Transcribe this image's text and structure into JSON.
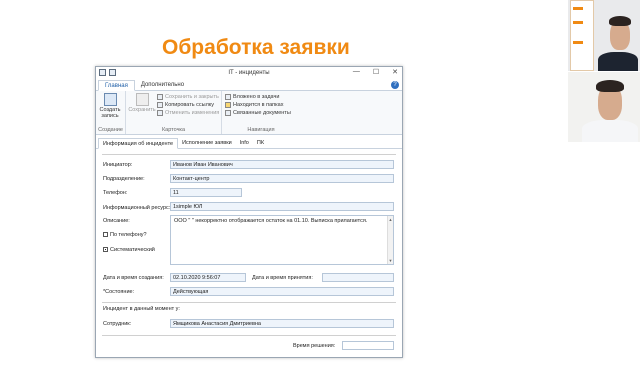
{
  "slide": {
    "title": "Обработка заявки"
  },
  "window": {
    "title": "IT - инциденты",
    "minimize": "—",
    "maximize": "☐",
    "close": "✕",
    "help": "?"
  },
  "ribbon": {
    "tabs": [
      "Главная",
      "Дополнительно"
    ],
    "create": {
      "label": "Создать запись"
    },
    "create_group": "Создание",
    "save": {
      "label": "Сохранить"
    },
    "card_items": [
      "Сохранить и закрыть",
      "Копировать ссылку",
      "Отменить изменения"
    ],
    "card_group": "Карточка",
    "nav_items": [
      "Вложено в задачи",
      "Находится в папках",
      "Связанные документы"
    ],
    "nav_group": "Навигация"
  },
  "form_tabs": [
    "Информация об инциденте",
    "Исполнение заявки",
    "Info",
    "ПК"
  ],
  "form": {
    "initiator_label": "Инициатор:",
    "initiator_value": "Иванов Иван Иванович",
    "department_label": "Подразделение:",
    "department_value": "Контакт-центр",
    "phone_label": "Телефон:",
    "phone_value": "11",
    "resource_label": "Информационный ресурс:",
    "resource_value": "1simple ЮЛ",
    "description_label": "Описание:",
    "description_value": "ООО \"          \" некорректно отображается  остаток на 01.10. Выписка прилагается.",
    "by_phone_label": "По телефону?",
    "systematic_label": "Систематический",
    "created_label": "Дата и время создания:",
    "created_value": "02.10.2020 9:56:07",
    "accepted_label": "Дата и время принятия:",
    "accepted_value": "",
    "state_label": "*Состояние:",
    "state_value": "Действующая",
    "incident_section": "Инцидент в данный момент у:",
    "employee_label": "Сотрудник:",
    "employee_value": "Ямщикова Анастасия Дмитриевна",
    "resolution_label": "Время решения:",
    "resolution_value": ""
  },
  "colors": {
    "title_orange": "#f08a13",
    "field_bg": "#eef4fb",
    "tab_blue": "#1f5fa8"
  }
}
